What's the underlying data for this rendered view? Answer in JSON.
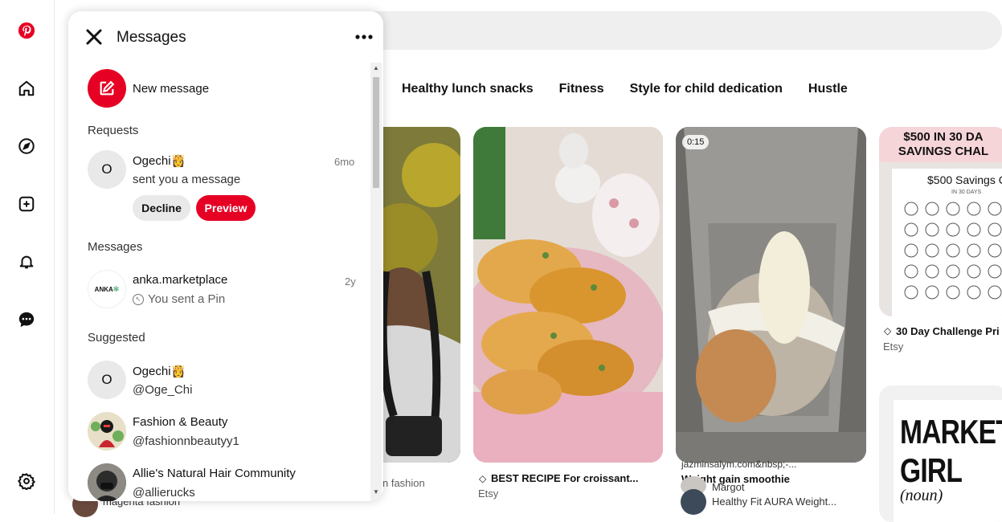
{
  "search": {
    "placeholder": ""
  },
  "topics": [
    "Healthy lunch snacks",
    "Fitness",
    "Style for child dedication",
    "Hustle"
  ],
  "pins": {
    "fashion": {
      "caption_tail": "n fashion",
      "author": "magenta fashion"
    },
    "croissant": {
      "caption": "BEST RECIPE For croissant...",
      "source": "Etsy"
    },
    "smoothie": {
      "badge": "0:15",
      "overlay_title": "jazminsalym.com&nbsp;-...",
      "title": "Weight gain smoothie",
      "author_1": "Margot",
      "author_2": "Healthy Fit AURA Weight..."
    },
    "savings": {
      "headline_1": "$500 IN 30 DA",
      "headline_2": "SAVINGS CHAL",
      "card_title": "$500 Savings Ch",
      "card_sub": "IN 30 DAYS",
      "caption": "30 Day Challenge Pri",
      "source": "Etsy"
    },
    "market": {
      "line_1": "MARKET",
      "line_2": "GIRL",
      "line_3": "(noun)"
    }
  },
  "panel": {
    "title": "Messages",
    "new_message": "New message",
    "requests_label": "Requests",
    "request": {
      "initial": "O",
      "name": "Ogechi👸",
      "text": "sent you a message",
      "time": "6mo",
      "decline": "Decline",
      "preview": "Preview"
    },
    "messages_label": "Messages",
    "message": {
      "name": "anka.marketplace",
      "logo_text": "ANKA",
      "text": "You sent a Pin",
      "time": "2y"
    },
    "suggested_label": "Suggested",
    "suggested": [
      {
        "initial": "O",
        "name": "Ogechi👸",
        "handle": "@Oge_Chi"
      },
      {
        "name": "Fashion & Beauty",
        "handle": "@fashionnbeautyy1"
      },
      {
        "name": "Allie's Natural Hair Community",
        "handle": "@allierucks"
      }
    ]
  },
  "colors": {
    "brand": "#e60023",
    "chip": "#efefef"
  }
}
